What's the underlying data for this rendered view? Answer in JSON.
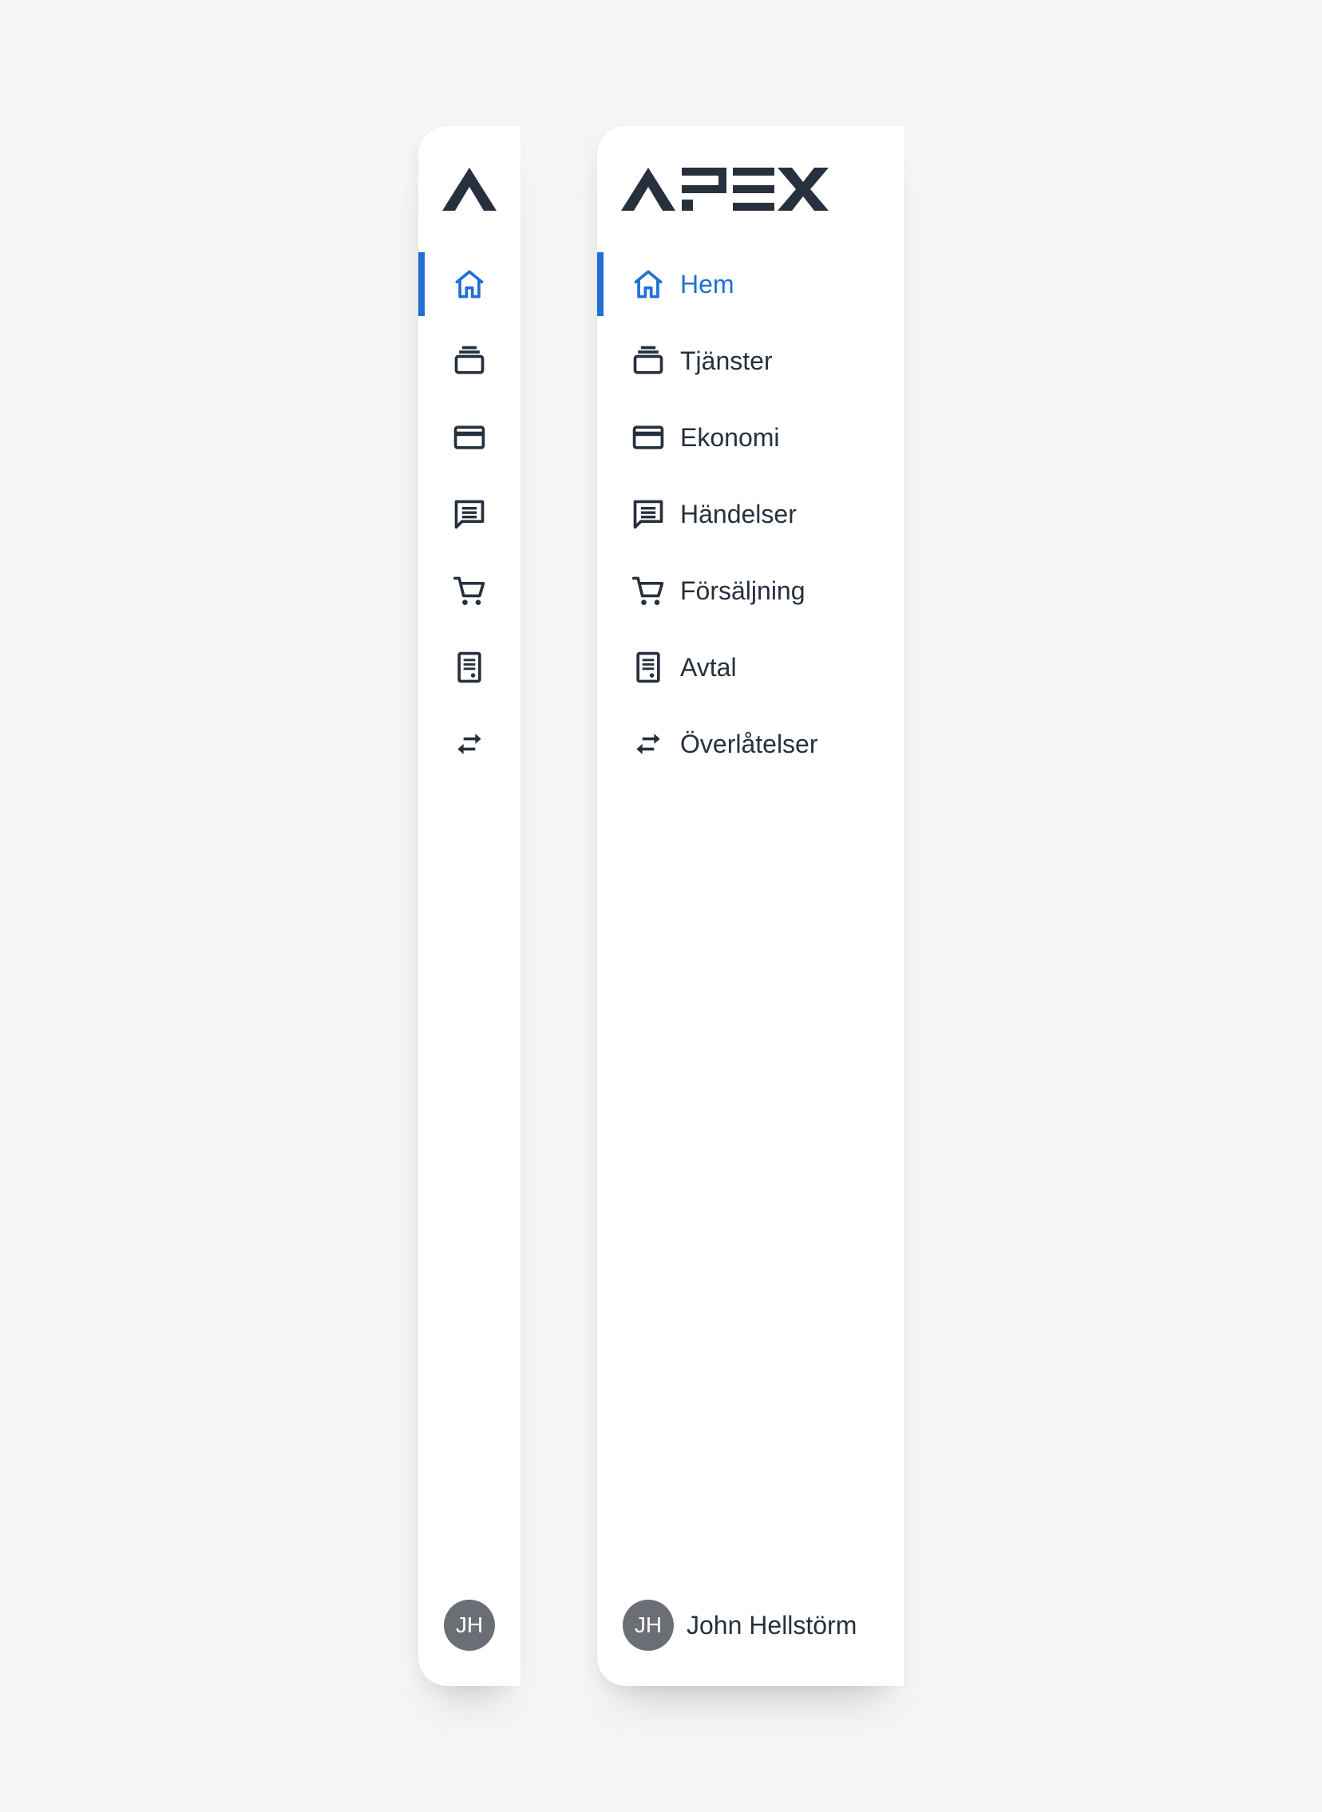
{
  "brand": {
    "name": "APEX",
    "accent_color": "#1f6fd6",
    "text_color": "#27303d"
  },
  "nav": {
    "items": [
      {
        "label": "Hem",
        "icon": "home-icon",
        "active": true
      },
      {
        "label": "Tjänster",
        "icon": "services-stack-icon",
        "active": false
      },
      {
        "label": "Ekonomi",
        "icon": "credit-card-icon",
        "active": false
      },
      {
        "label": "Händelser",
        "icon": "message-icon",
        "active": false
      },
      {
        "label": "Försäljning",
        "icon": "shopping-cart-icon",
        "active": false
      },
      {
        "label": "Avtal",
        "icon": "document-icon",
        "active": false
      },
      {
        "label": "Överlåtelser",
        "icon": "transfer-arrows-icon",
        "active": false
      }
    ]
  },
  "user": {
    "initials": "JH",
    "name": "John Hellstörm"
  }
}
